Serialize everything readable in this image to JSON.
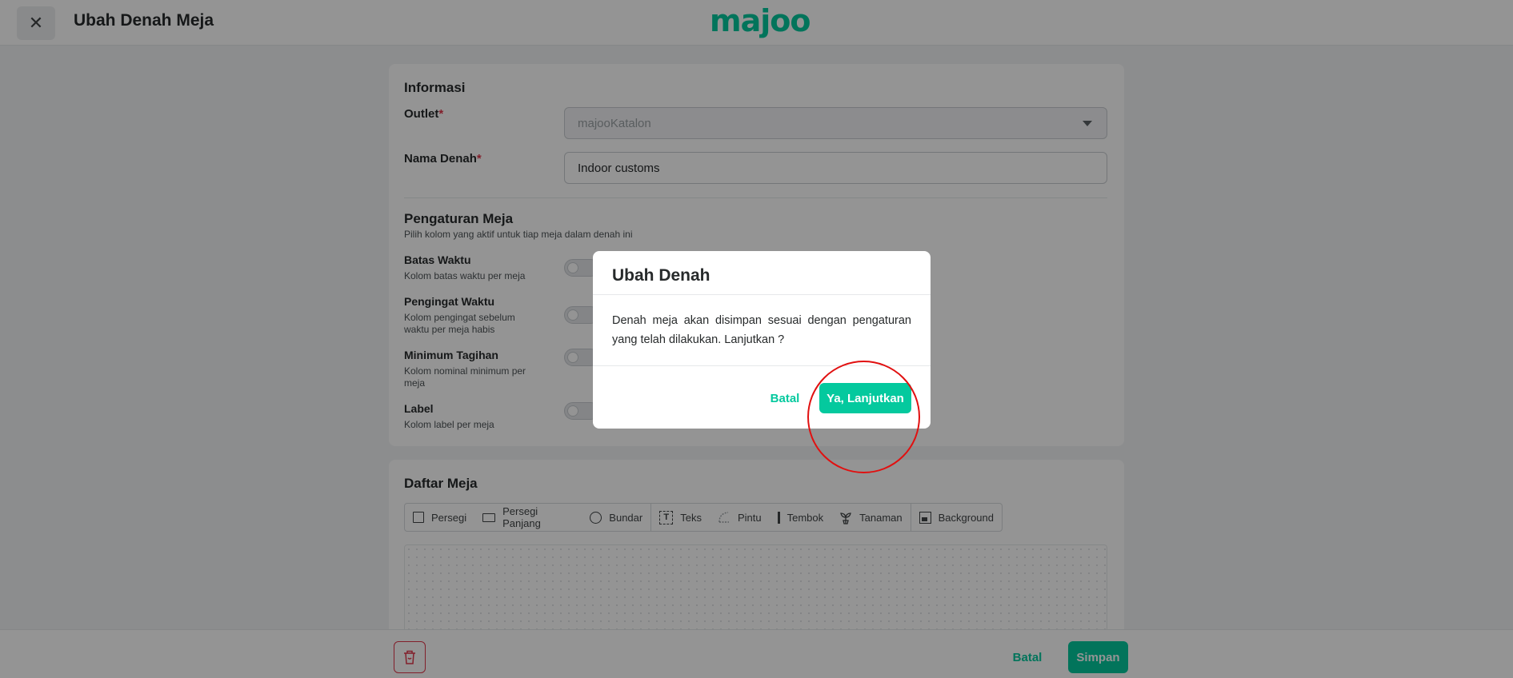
{
  "header": {
    "title": "Ubah Denah Meja",
    "logo_text": "majoo",
    "close_icon": "close-icon"
  },
  "info": {
    "section_title": "Informasi",
    "outlet_label": "Outlet",
    "outlet_value": "majooKatalon",
    "name_label": "Nama Denah",
    "name_value": "Indoor customs",
    "required_mark": "*"
  },
  "settings": {
    "section_title": "Pengaturan Meja",
    "section_sub": "Pilih kolom yang aktif untuk tiap meja dalam denah ini",
    "items": [
      {
        "label": "Batas Waktu",
        "desc": "Kolom batas waktu per meja"
      },
      {
        "label": "Pengingat Waktu",
        "desc": "Kolom pengingat sebelum waktu per meja habis"
      },
      {
        "label": "Minimum Tagihan",
        "desc": "Kolom nominal minimum per meja"
      },
      {
        "label": "Label",
        "desc": "Kolom label per meja"
      }
    ]
  },
  "tables": {
    "section_title": "Daftar Meja",
    "tools": [
      {
        "label": "Persegi",
        "icon": "square-icon"
      },
      {
        "label": "Persegi Panjang",
        "icon": "rectangle-icon"
      },
      {
        "label": "Bundar",
        "icon": "circle-icon"
      },
      {
        "label": "Teks",
        "icon": "text-icon"
      },
      {
        "label": "Pintu",
        "icon": "door-icon"
      },
      {
        "label": "Tembok",
        "icon": "wall-icon"
      },
      {
        "label": "Tanaman",
        "icon": "plant-icon"
      },
      {
        "label": "Background",
        "icon": "image-icon"
      }
    ]
  },
  "footer": {
    "cancel_label": "Batal",
    "save_label": "Simpan",
    "delete_icon": "trash-icon"
  },
  "modal": {
    "title": "Ubah Denah",
    "body": "Denah meja akan disimpan sesuai dengan pengaturan yang telah dilakukan. Lanjutkan ?",
    "cancel_label": "Batal",
    "confirm_label": "Ya, Lanjutkan"
  },
  "colors": {
    "accent": "#04c99e",
    "danger": "#e1364a",
    "highlight": "#e11010"
  }
}
